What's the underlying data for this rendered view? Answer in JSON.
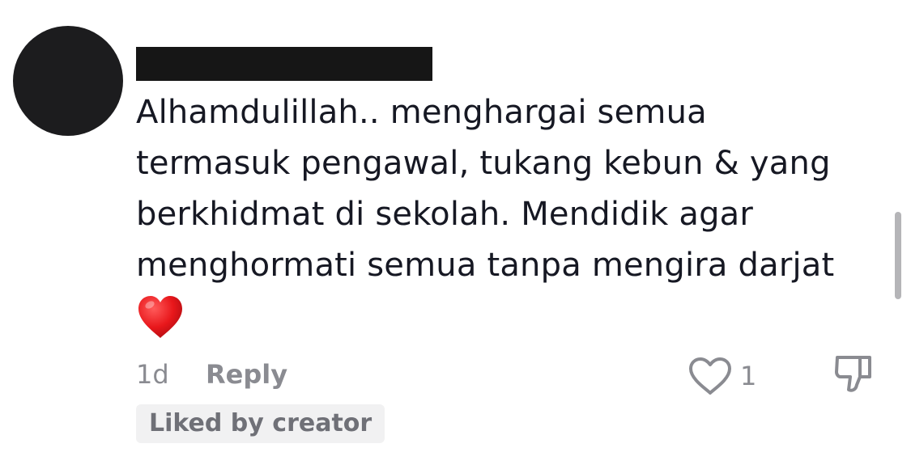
{
  "comment": {
    "lines": [
      "Alhamdulillah.. menghargai semua",
      "termasuk pengawal, tukang kebun & yang",
      "berkhidmat di sekolah. Mendidik agar",
      "menghormati semua tanpa mengira darjat"
    ],
    "emoji": "heart-emoji"
  },
  "meta": {
    "timestamp": "1d",
    "reply_label": "Reply",
    "like_count": "1"
  },
  "badge": {
    "liked_by_creator": "Liked by creator"
  },
  "icons": {
    "like": "heart-outline-icon",
    "dislike": "thumbs-down-icon"
  },
  "colors": {
    "text": "#161823",
    "muted": "#8a8b91",
    "badge_bg": "#f1f1f2",
    "heart": "#e8171b"
  }
}
